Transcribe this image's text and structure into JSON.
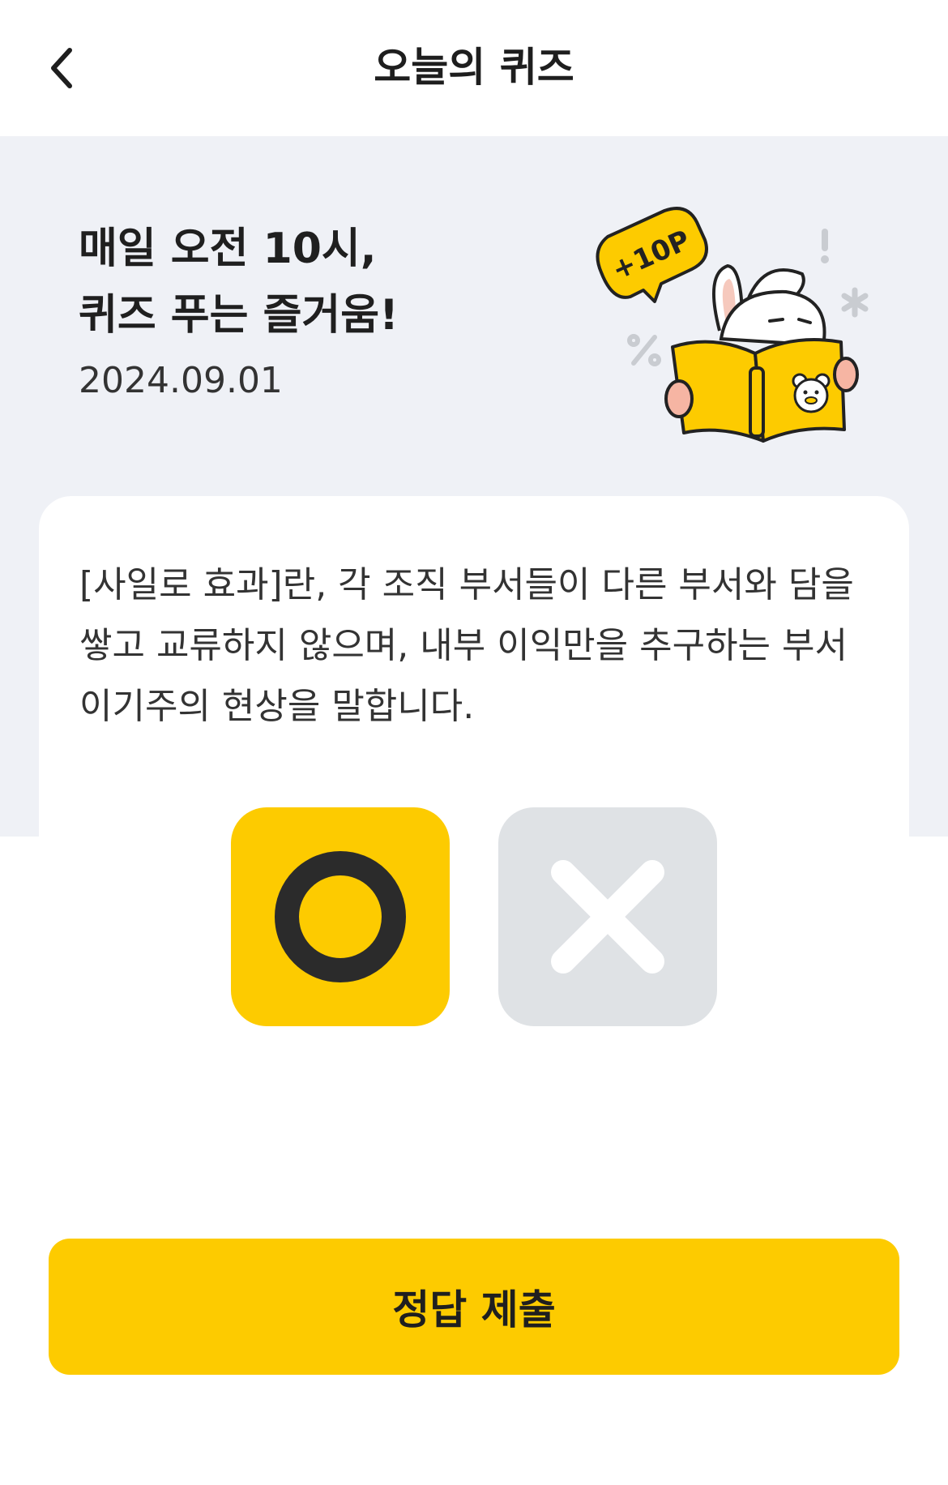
{
  "header": {
    "title": "오늘의 퀴즈",
    "back_icon": "chevron-left-icon"
  },
  "hero": {
    "title_lines": [
      "매일 오전 10시,",
      "퀴즈 푸는 즐거움!"
    ],
    "date": "2024.09.01",
    "badge": "+10P",
    "illustration": "rabbit-reading-book-illustration"
  },
  "quiz": {
    "question_lines": [
      "[사일로 효과]란, 각 조직 부서들이 다른 부서와 담을",
      "쌓고 교류하지 않으며, 내부 이익만을 추구하는 부서",
      "이기주의 현상을 말합니다."
    ],
    "options": [
      {
        "label": "O",
        "icon": "circle-o-icon",
        "selected": true
      },
      {
        "label": "X",
        "icon": "x-cross-icon",
        "selected": false
      }
    ]
  },
  "submit": {
    "label": "정답 제출"
  },
  "colors": {
    "accent": "#fdcb00",
    "hero_bg": "#eff1f6",
    "option_inactive": "#dfe2e5",
    "text": "#222222"
  }
}
